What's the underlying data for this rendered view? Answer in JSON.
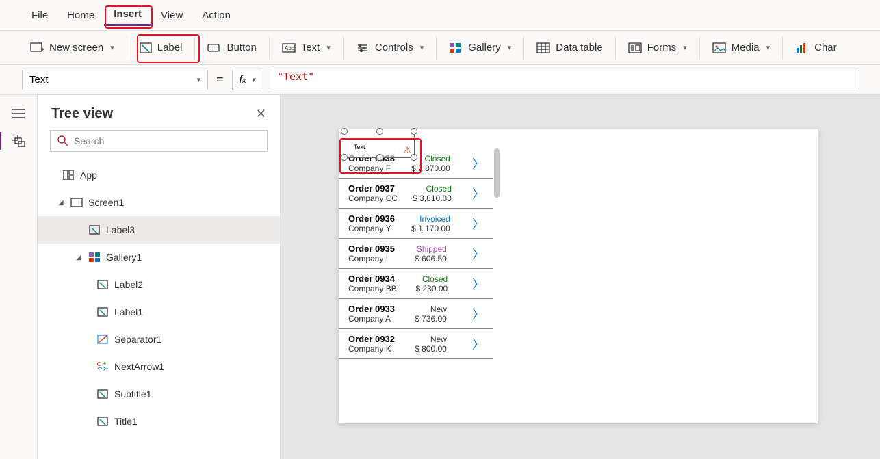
{
  "menu": {
    "file": "File",
    "home": "Home",
    "insert": "Insert",
    "view": "View",
    "action": "Action"
  },
  "ribbon": {
    "new_screen": "New screen",
    "label": "Label",
    "button": "Button",
    "text": "Text",
    "controls": "Controls",
    "gallery": "Gallery",
    "data_table": "Data table",
    "forms": "Forms",
    "media": "Media",
    "charts": "Char"
  },
  "formula": {
    "property": "Text",
    "value": "\"Text\""
  },
  "treeview": {
    "title": "Tree view",
    "search_placeholder": "Search",
    "app": "App",
    "screen1": "Screen1",
    "label3": "Label3",
    "gallery1": "Gallery1",
    "label2": "Label2",
    "label1": "Label1",
    "separator1": "Separator1",
    "nextarrow1": "NextArrow1",
    "subtitle1": "Subtitle1",
    "title1": "Title1"
  },
  "label_preview": "Text",
  "orders": [
    {
      "id": "Order 0938",
      "company": "Company F",
      "status": "Closed",
      "amount": "$ 2,870.00"
    },
    {
      "id": "Order 0937",
      "company": "Company CC",
      "status": "Closed",
      "amount": "$ 3,810.00"
    },
    {
      "id": "Order 0936",
      "company": "Company Y",
      "status": "Invoiced",
      "amount": "$ 1,170.00"
    },
    {
      "id": "Order 0935",
      "company": "Company I",
      "status": "Shipped",
      "amount": "$ 606.50"
    },
    {
      "id": "Order 0934",
      "company": "Company BB",
      "status": "Closed",
      "amount": "$ 230.00"
    },
    {
      "id": "Order 0933",
      "company": "Company A",
      "status": "New",
      "amount": "$ 736.00"
    },
    {
      "id": "Order 0932",
      "company": "Company K",
      "status": "New",
      "amount": "$ 800.00"
    }
  ]
}
